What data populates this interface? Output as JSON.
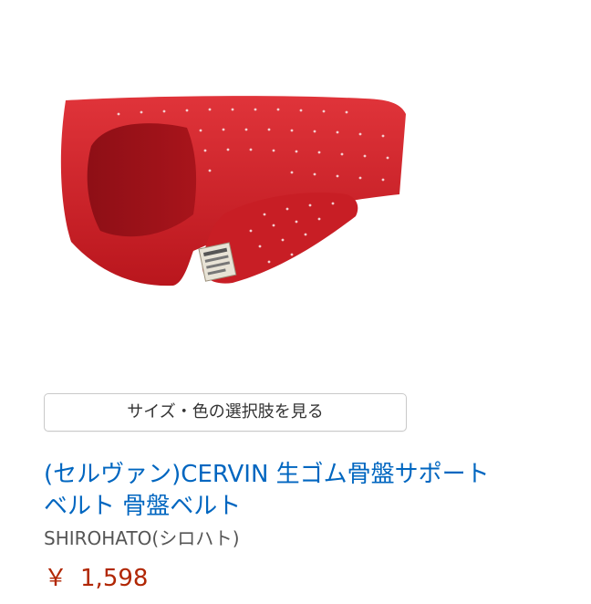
{
  "product": {
    "image_alt": "red pelvic support belt",
    "variant_button_label": "サイズ・色の選択肢を見る",
    "title_line1": "(セルヴァン)CERVIN 生ゴム骨盤サポート",
    "title_line2": "ベルト 骨盤ベルト",
    "brand": "SHIROHATO(シロハト)",
    "price_currency": "￥",
    "price_value": "1,598"
  },
  "colors": {
    "link": "#0066c0",
    "price": "#b12704",
    "belt_red": "#c81e25"
  }
}
